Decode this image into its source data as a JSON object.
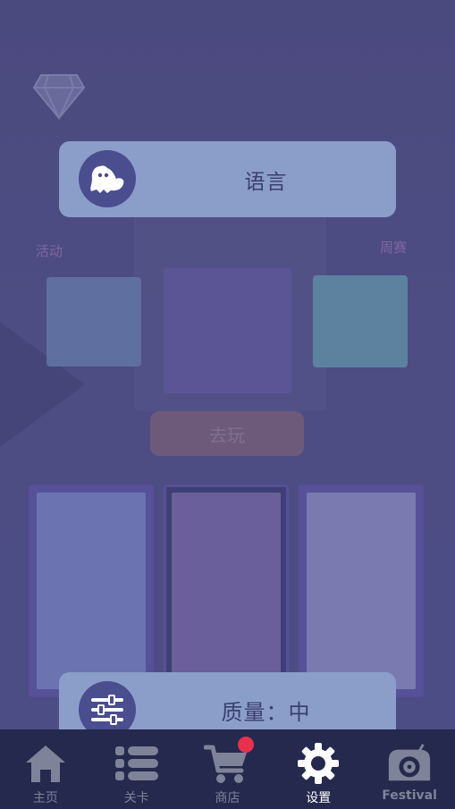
{
  "background": {
    "event_label": "活动",
    "week_label": "周赛",
    "play_button_label": "去玩"
  },
  "settings": {
    "language": {
      "label": "语言",
      "icon": "ghost-icon"
    },
    "quality": {
      "label": "质量：中",
      "icon": "sliders-icon"
    }
  },
  "nav": {
    "items": [
      {
        "label": "主页",
        "icon": "home-icon",
        "active": false
      },
      {
        "label": "关卡",
        "icon": "list-icon",
        "active": false
      },
      {
        "label": "商店",
        "icon": "cart-icon",
        "active": false,
        "badge": true
      },
      {
        "label": "设置",
        "icon": "gear-icon",
        "active": true
      },
      {
        "label": "Festival",
        "icon": "record-player-icon",
        "active": false
      }
    ]
  },
  "colors": {
    "panel": "#8b9ec9",
    "nav_bg": "#24294d",
    "badge": "#e8304f",
    "icon_circle": "#4a4d8e"
  }
}
